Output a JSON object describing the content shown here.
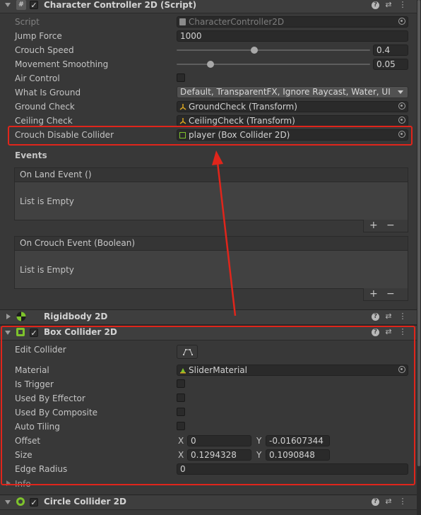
{
  "character_controller": {
    "title": "Character Controller 2D (Script)",
    "enabled": true,
    "script": {
      "label": "Script",
      "value": "CharacterController2D"
    },
    "jump_force": {
      "label": "Jump Force",
      "value": "1000"
    },
    "crouch_speed": {
      "label": "Crouch Speed",
      "value": "0.4",
      "fraction": 0.4
    },
    "movement_smoothing": {
      "label": "Movement Smoothing",
      "value": "0.05",
      "fraction": 0.175
    },
    "air_control": {
      "label": "Air Control",
      "checked": false
    },
    "what_is_ground": {
      "label": "What Is Ground",
      "value": "Default, TransparentFX, Ignore Raycast, Water, UI"
    },
    "ground_check": {
      "label": "Ground Check",
      "value": "GroundCheck (Transform)"
    },
    "ceiling_check": {
      "label": "Ceiling Check",
      "value": "CeilingCheck (Transform)"
    },
    "crouch_disable_collider": {
      "label": "Crouch Disable Collider",
      "value": "player (Box Collider 2D)"
    },
    "events": {
      "label": "Events",
      "on_land": {
        "title": "On Land Event ()",
        "empty": "List is Empty"
      },
      "on_crouch": {
        "title": "On Crouch Event (Boolean)",
        "empty": "List is Empty"
      },
      "add": "+",
      "remove": "−"
    }
  },
  "rigidbody": {
    "title": "Rigidbody 2D"
  },
  "box_collider": {
    "title": "Box Collider 2D",
    "enabled": true,
    "edit_collider": {
      "label": "Edit Collider"
    },
    "material": {
      "label": "Material",
      "value": "SliderMaterial"
    },
    "is_trigger": {
      "label": "Is Trigger",
      "checked": false
    },
    "used_by_effector": {
      "label": "Used By Effector",
      "checked": false
    },
    "used_by_composite": {
      "label": "Used By Composite",
      "checked": false
    },
    "auto_tiling": {
      "label": "Auto Tiling",
      "checked": false
    },
    "offset": {
      "label": "Offset",
      "x_label": "X",
      "x": "0",
      "y_label": "Y",
      "y": "-0.01607344"
    },
    "size": {
      "label": "Size",
      "x_label": "X",
      "x": "0.1294328",
      "y_label": "Y",
      "y": "0.1090848"
    },
    "edge_radius": {
      "label": "Edge Radius",
      "value": "0"
    },
    "info": {
      "label": "Info"
    }
  },
  "circle_collider": {
    "title": "Circle Collider 2D",
    "enabled": true
  },
  "icons": {
    "header_buttons": [
      "help-icon",
      "preset-icon",
      "kebab-menu-icon"
    ],
    "help": "?",
    "preset": "⇄",
    "kebab": "⋮"
  },
  "colors": {
    "annotation": "#e0251b",
    "background": "#383838",
    "header": "#3e3e3e"
  }
}
